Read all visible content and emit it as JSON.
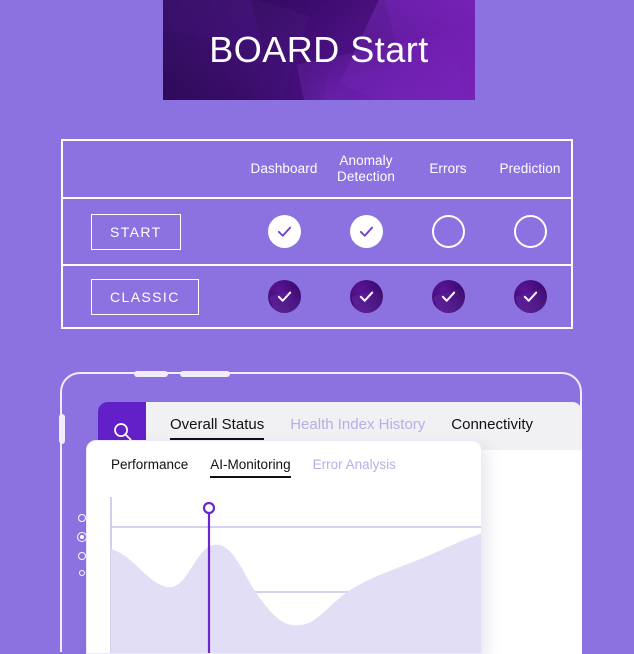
{
  "banner": {
    "title": "BOARD Start"
  },
  "comparison_table": {
    "columns": [
      "Dashboard",
      "Anomaly\nDetection",
      "Errors",
      "Prediction"
    ],
    "column_labels": [
      {
        "line1": "Dashboard",
        "line2": ""
      },
      {
        "line1": "Anomaly",
        "line2": "Detection"
      },
      {
        "line1": "Errors",
        "line2": ""
      },
      {
        "line1": "Prediction",
        "line2": ""
      }
    ],
    "rows": [
      {
        "label": "START",
        "marks": [
          "check-filled",
          "check-filled",
          "empty",
          "empty"
        ]
      },
      {
        "label": "CLASSIC",
        "marks": [
          "check-dark",
          "check-dark",
          "check-dark",
          "check-dark"
        ]
      }
    ]
  },
  "app": {
    "sidebar_icons": [
      "search-icon",
      "calendar-icon",
      "location-pin-bolt-icon",
      "user-avatar-icon"
    ],
    "tabs": [
      {
        "label": "Overall Status",
        "state": "active"
      },
      {
        "label": "Health Index History",
        "state": "muted"
      },
      {
        "label": "Connectivity",
        "state": "normal"
      }
    ],
    "card_tabs": [
      {
        "label": "Performance",
        "state": "normal"
      },
      {
        "label": "AI-Monitoring",
        "state": "active"
      },
      {
        "label": "Error Analysis",
        "state": "muted"
      }
    ]
  },
  "chart_data": {
    "type": "area",
    "title": "",
    "xlabel": "",
    "ylabel": "",
    "series": [
      {
        "name": "AI-Monitoring",
        "x": [
          0,
          8,
          16,
          24,
          32,
          40,
          48,
          56,
          64,
          72,
          80,
          88,
          100
        ],
        "values": [
          62,
          50,
          36,
          34,
          48,
          66,
          68,
          52,
          30,
          20,
          26,
          44,
          58,
          72
        ]
      }
    ],
    "gridlines_y": [
      70,
      38
    ],
    "marker": {
      "x": 28,
      "label": "",
      "style": "vertical-line-with-circle"
    },
    "colors": {
      "area_fill": "#E2DEF5",
      "marker": "#6B27CF",
      "grid": "#C9C2EA"
    },
    "ylim": [
      0,
      100
    ],
    "legend": "none",
    "grid": true
  },
  "colors": {
    "background": "#8B72E0",
    "banner_dark": "#2E0561",
    "banner_light": "#6B15A8",
    "sidebar": "#6320C8",
    "accent_check": "#6B3FD4",
    "muted_text": "#B8AEE8"
  }
}
